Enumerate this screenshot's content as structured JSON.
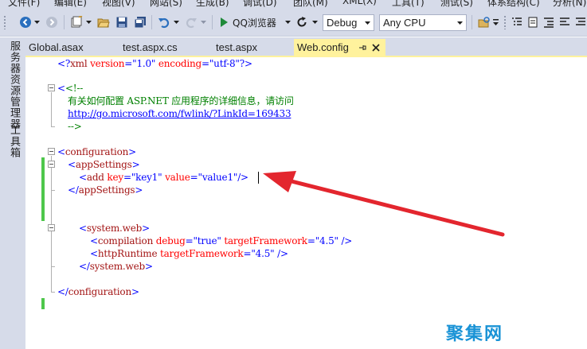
{
  "menu": {
    "items": [
      "文件(F)",
      "编辑(E)",
      "视图(V)",
      "网站(S)",
      "生成(B)",
      "调试(D)",
      "团队(M)",
      "XML(X)",
      "工具(T)",
      "测试(S)",
      "体系结构(C)",
      "分析(N)"
    ]
  },
  "toolbar": {
    "browser_label": "QQ浏览器",
    "config_value": "Debug",
    "platform_value": "Any CPU"
  },
  "sidestrip": {
    "server_explorer": "服务器资源管理器",
    "toolbox": "工具箱"
  },
  "tabs": [
    {
      "label": "Global.asax"
    },
    {
      "label": "test.aspx.cs"
    },
    {
      "label": "test.aspx"
    },
    {
      "label": "Web.config",
      "active": true
    }
  ],
  "code": {
    "xml_decl": {
      "open": "<?",
      "name": "xml",
      "a1": " version",
      "v1": "\"1.0\"",
      "a2": " encoding",
      "v2": "\"utf-8\"",
      "close": "?>"
    },
    "comment_open": "<!--",
    "comment_text": "有关如何配置 ASP.NET 应用程序的详细信息，请访问",
    "comment_link": "http://go.microsoft.com/fwlink/?LinkId=169433",
    "comment_close": "-->",
    "configuration_open": "configuration",
    "appsettings_open": "appSettings",
    "add_tag": "add",
    "add_key_attr": " key",
    "add_key_val": "\"key1\"",
    "add_value_attr": " value",
    "add_value_val": "\"value1\"",
    "appsettings_close": "appSettings",
    "systemweb_open": "system.web",
    "compilation_tag": "compilation",
    "compilation_debug_attr": " debug",
    "compilation_debug_val": "\"true\"",
    "compilation_fw_attr": " targetFramework",
    "compilation_fw_val": "\"4.5\"",
    "httpruntime_tag": "httpRuntime",
    "httpruntime_fw_attr": " targetFramework",
    "httpruntime_fw_val": "\"4.5\"",
    "systemweb_close": "system.web",
    "configuration_close": "configuration"
  },
  "watermark": "聚集网",
  "colors": {
    "chrome": "#d6dbe9",
    "active_tab": "#fff29d",
    "arrow": "#e3262e",
    "change_marker": "#4ec74b"
  }
}
